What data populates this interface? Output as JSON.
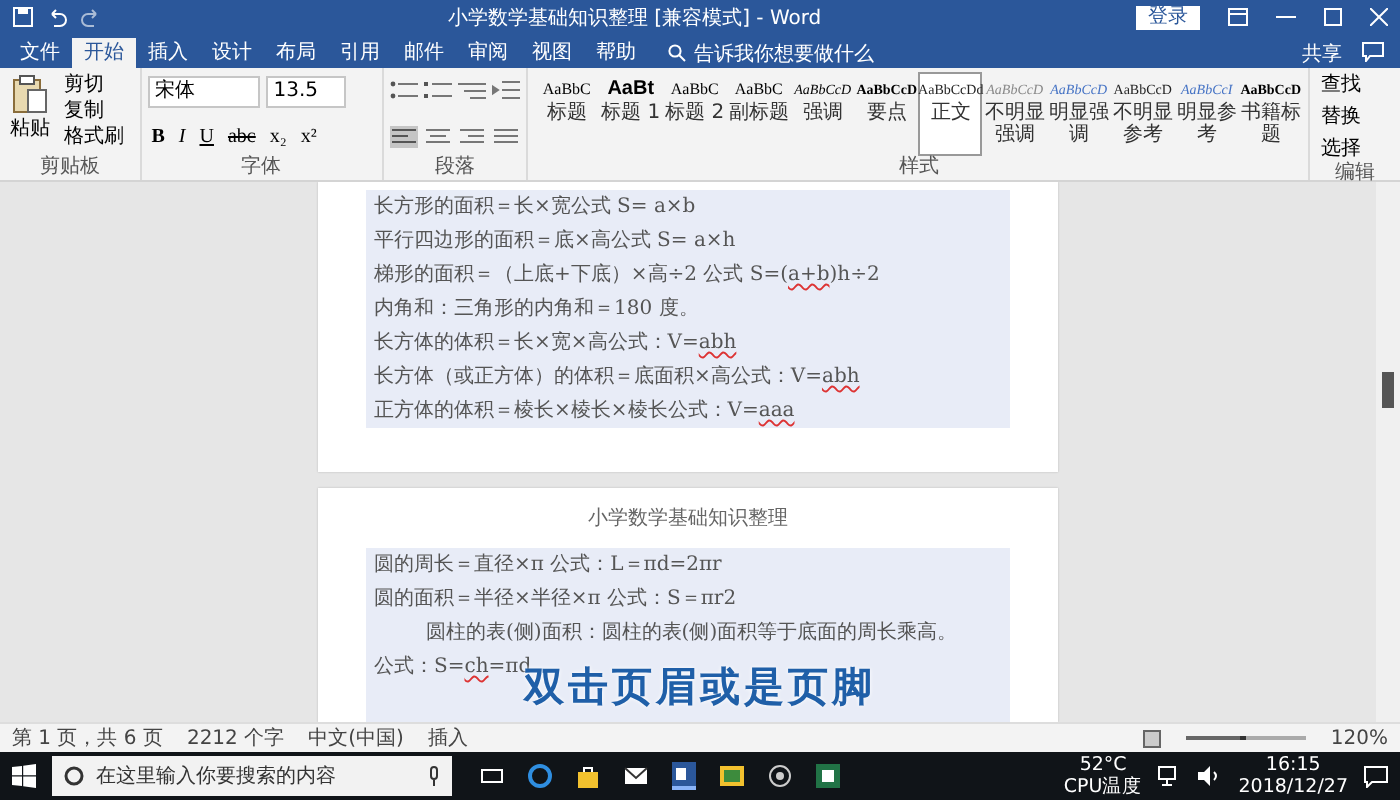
{
  "window": {
    "title": "小学数学基础知识整理 [兼容模式] - Word",
    "login": "登录"
  },
  "tabs": [
    {
      "label": "文件",
      "selected": false
    },
    {
      "label": "开始",
      "selected": true
    },
    {
      "label": "插入",
      "selected": false
    },
    {
      "label": "设计",
      "selected": false
    },
    {
      "label": "布局",
      "selected": false
    },
    {
      "label": "引用",
      "selected": false
    },
    {
      "label": "邮件",
      "selected": false
    },
    {
      "label": "审阅",
      "selected": false
    },
    {
      "label": "视图",
      "selected": false
    },
    {
      "label": "帮助",
      "selected": false
    }
  ],
  "tell_me": "告诉我你想要做什么",
  "share": "共享",
  "ribbon": {
    "clipboard": {
      "paste": "粘贴",
      "actions": [
        "剪切",
        "复制",
        "格式刷"
      ],
      "label": "剪贴板"
    },
    "font": {
      "name": "宋体",
      "size": "13.5",
      "buttons": [
        "B",
        "I",
        "U",
        "abc",
        "x₂",
        "x²"
      ],
      "label": "字体"
    },
    "paragraph": {
      "label": "段落"
    },
    "styles": {
      "label": "样式",
      "items": [
        {
          "sample": "AaBbC",
          "name": "标题",
          "kind": "title",
          "selected": false
        },
        {
          "sample": "AaBt",
          "name": "标题 1",
          "kind": "heading",
          "selected": false
        },
        {
          "sample": "AaBbC",
          "name": "标题 2",
          "kind": "title",
          "selected": false
        },
        {
          "sample": "AaBbC",
          "name": "副标题",
          "kind": "title",
          "selected": false
        },
        {
          "sample": "AaBbCcD",
          "name": "强调",
          "kind": "italic",
          "selected": false
        },
        {
          "sample": "AaBbCcD",
          "name": "要点",
          "kind": "strong",
          "selected": false
        },
        {
          "sample": "AaBbCcDd",
          "name": "正文",
          "kind": "normal",
          "selected": true
        },
        {
          "sample": "AaBbCcD",
          "name": "不明显强调",
          "kind": "subtle",
          "selected": false
        },
        {
          "sample": "AaBbCcD",
          "name": "明显强调",
          "kind": "accent",
          "selected": false
        },
        {
          "sample": "AaBbCcD",
          "name": "不明显参考",
          "kind": "normal",
          "selected": false
        },
        {
          "sample": "AaBbCcI",
          "name": "明显参考",
          "kind": "accent",
          "selected": false
        },
        {
          "sample": "AaBbCcD",
          "name": "书籍标题",
          "kind": "strong",
          "selected": false
        }
      ]
    },
    "editing": {
      "actions": [
        "查找",
        "替换",
        "选择"
      ],
      "label": "编辑"
    }
  },
  "pages": [
    {
      "highlighted": true,
      "lines": [
        {
          "kind": "plain",
          "parts": [
            {
              "text": "长方形的面积＝长×宽公式 S= a×b",
              "flagged": false
            }
          ]
        },
        {
          "kind": "plain",
          "parts": [
            {
              "text": "平行四边形的面积＝底×高公式 S= a×h",
              "flagged": false
            }
          ]
        },
        {
          "kind": "plain",
          "parts": [
            {
              "text": "梯形的面积＝（上底+下底）×高÷2 公式 S=(",
              "flagged": false
            },
            {
              "text": "a+b",
              "flagged": true
            },
            {
              "text": ")h÷2",
              "flagged": false
            }
          ]
        },
        {
          "kind": "plain",
          "parts": [
            {
              "text": "内角和：三角形的内角和＝180 度。",
              "flagged": false
            }
          ]
        },
        {
          "kind": "plain",
          "parts": [
            {
              "text": "长方体的体积＝长×宽×高公式：V=",
              "flagged": false
            },
            {
              "text": "abh",
              "flagged": true
            }
          ]
        },
        {
          "kind": "plain",
          "parts": [
            {
              "text": "长方体（或正方体）的体积＝底面积×高公式：V=",
              "flagged": false
            },
            {
              "text": "abh",
              "flagged": true
            }
          ]
        },
        {
          "kind": "plain",
          "parts": [
            {
              "text": "正方体的体积＝棱长×棱长×棱长公式：V=",
              "flagged": false
            },
            {
              "text": "aaa",
              "flagged": true
            }
          ]
        }
      ]
    },
    {
      "header": "小学数学基础知识整理",
      "highlighted": true,
      "lines": [
        {
          "kind": "plain",
          "parts": [
            {
              "text": "圆的周长＝直径×π 公式：L＝πd=2πr",
              "flagged": false
            }
          ]
        },
        {
          "kind": "plain",
          "parts": [
            {
              "text": "圆的面积＝半径×半径×π 公式：S＝πr2",
              "flagged": false
            }
          ]
        },
        {
          "kind": "indented",
          "parts": [
            {
              "text": "圆柱的表(侧)面积：圆柱的表(侧)面积等于底面的周长乘高。",
              "flagged": false
            }
          ]
        },
        {
          "kind": "plain",
          "parts": [
            {
              "text": "公式：S=",
              "flagged": false
            },
            {
              "text": "ch",
              "flagged": true
            },
            {
              "text": "=πd",
              "flagged": false
            }
          ]
        }
      ]
    }
  ],
  "caption": "双击页眉或是页脚",
  "status_bar": {
    "page": "第 1 页，共 6 页",
    "words": "2212 个字",
    "language": "中文(中国)",
    "mode": "插入",
    "zoom": "120%",
    "level": 0.5
  },
  "taskbar": {
    "search": "在这里输入你要搜索的内容",
    "temp": "52°C",
    "temp_label": "CPU温度",
    "time": "16:15",
    "date": "2018/12/27"
  }
}
